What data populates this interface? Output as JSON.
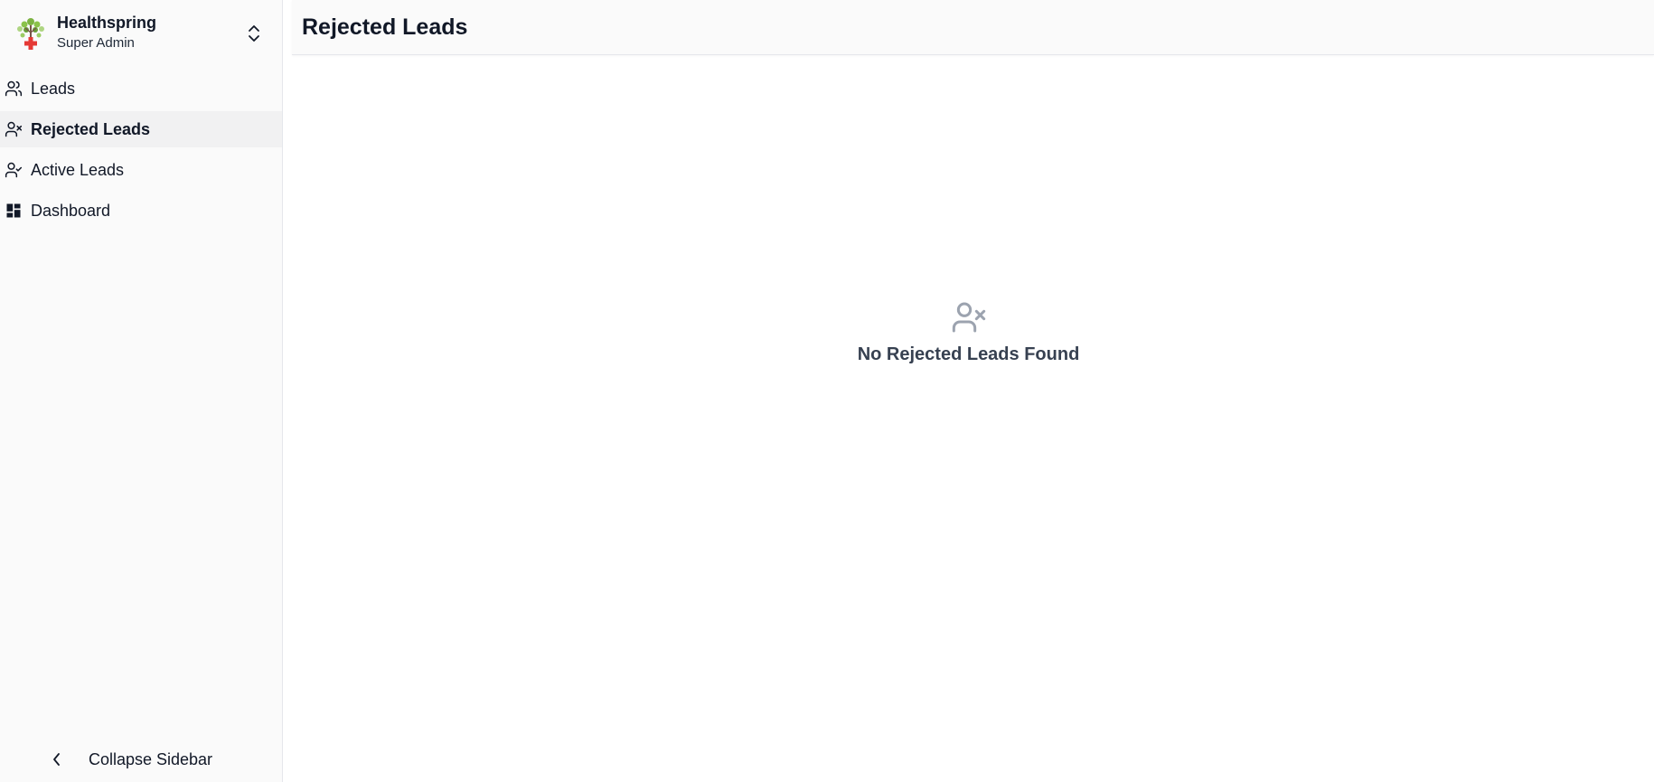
{
  "org": {
    "name": "Healthspring",
    "role": "Super Admin"
  },
  "nav": {
    "items": [
      {
        "label": "Leads",
        "icon": "users-icon",
        "active": false
      },
      {
        "label": "Rejected Leads",
        "icon": "user-x-icon",
        "active": true
      },
      {
        "label": "Active Leads",
        "icon": "user-check-icon",
        "active": false
      },
      {
        "label": "Dashboard",
        "icon": "dashboard-icon",
        "active": false
      }
    ]
  },
  "sidebar_footer": {
    "collapse_label": "Collapse Sidebar"
  },
  "header": {
    "title": "Rejected Leads"
  },
  "empty_state": {
    "message": "No Rejected Leads Found",
    "icon": "user-x-icon"
  },
  "colors": {
    "sidebar_bg": "#fafafa",
    "active_item_bg": "#f1f1f2",
    "empty_icon": "#9ca3af",
    "empty_text": "#374151"
  }
}
